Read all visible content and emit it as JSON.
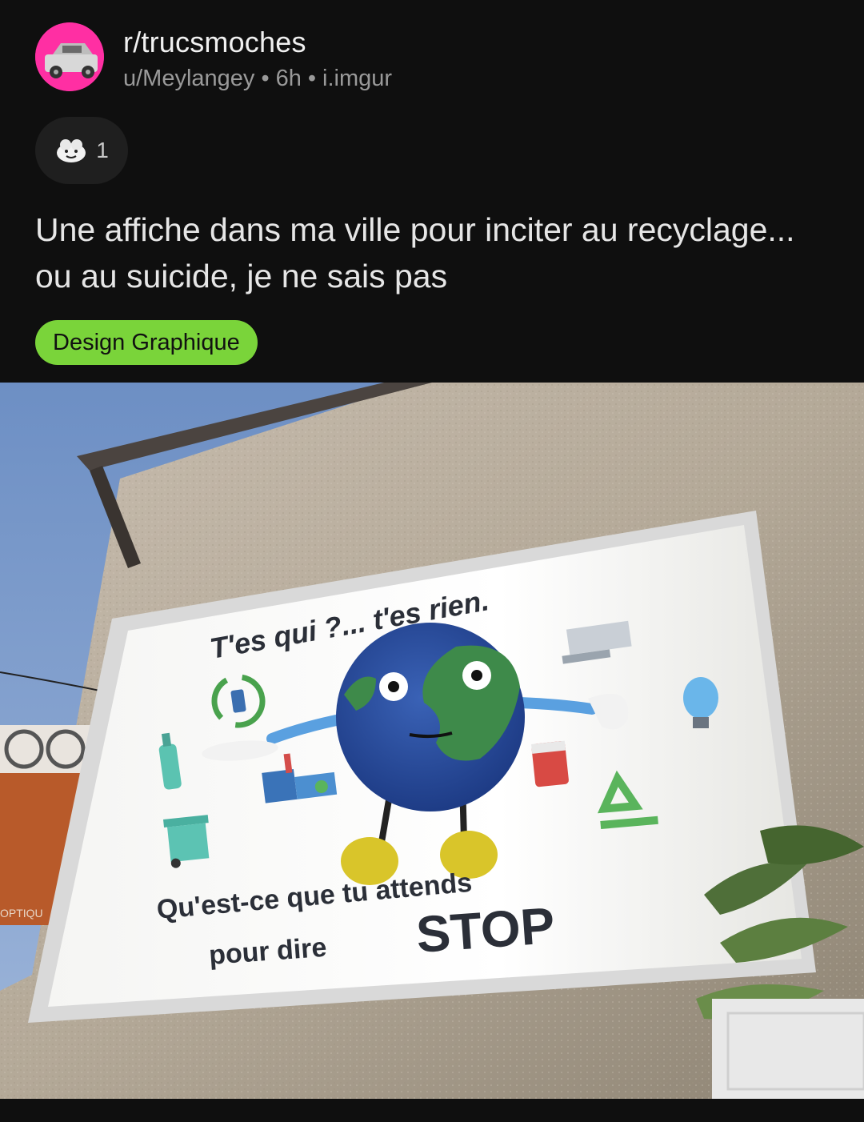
{
  "post": {
    "subreddit": "r/trucsmoches",
    "author": "u/Meylangey",
    "age": "6h",
    "domain": "i.imgur",
    "separator": "•",
    "award_count": "1",
    "title": "Une affiche dans ma ville pour inciter au recyclage... ou au suicide, je ne sais pas",
    "flair": "Design Graphique"
  },
  "poster": {
    "headline": "T'es qui ?... t'es rien.",
    "bottom_line_1": "Qu'est-ce que tu attends",
    "bottom_line_2_prefix": "pour dire",
    "bottom_line_2_emphasis": "STOP"
  },
  "storefront": {
    "sign_text": "OPTIQU"
  },
  "icons": {
    "subreddit_avatar": "car-icon",
    "award": "award-icon"
  },
  "colors": {
    "background": "#0f0f0f",
    "flair_bg": "#7ad43a",
    "avatar_bg": "#ff2fa3",
    "pill_bg": "#1f1f1f"
  }
}
